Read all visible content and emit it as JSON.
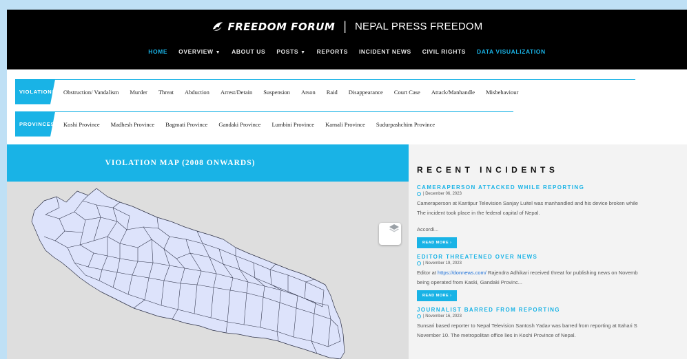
{
  "brand": {
    "logo_text": "FREEDOM FORUM",
    "separator": "|",
    "site_title": "NEPAL PRESS FREEDOM"
  },
  "nav": {
    "items": [
      {
        "label": "HOME",
        "active": true
      },
      {
        "label": "OVERVIEW",
        "caret": "▼"
      },
      {
        "label": "ABOUT US"
      },
      {
        "label": "POSTS",
        "caret": "▼"
      },
      {
        "label": "REPORTS"
      },
      {
        "label": "INCIDENT NEWS"
      },
      {
        "label": "CIVIL RIGHTS"
      },
      {
        "label": "DATA VISUALIZATION",
        "active": true
      }
    ]
  },
  "violation_filter": {
    "tag": "VIOLATIONS",
    "items": [
      "Obstruction/ Vandalism",
      "Murder",
      "Threat",
      "Abduction",
      "Arrest/Detain",
      "Suspension",
      "Arson",
      "Raid",
      "Disappearance",
      "Court Case",
      "Attack/Manhandle",
      "Misbehaviour"
    ]
  },
  "province_filter": {
    "tag": "PROVINCES",
    "items": [
      "Koshi Province",
      "Madhesh Province",
      "Bagmati Province",
      "Gandaki Province",
      "Lumbini Province",
      "Karnali Province",
      "Sudurpashchim Province"
    ]
  },
  "map": {
    "title": "VIOLATION MAP (2008 ONWARDS)",
    "layers_icon": "layers-icon"
  },
  "incidents": {
    "heading": "RECENT INCIDENTS",
    "read_more": "READ MORE ›",
    "items": [
      {
        "title": "CAMERAPERSON ATTACKED WHILE REPORTING",
        "date": "| December 06, 2023",
        "line1": "Cameraperson at Kantipur Television Sanjay Luitel was manhandled and his device broken while",
        "line2": "The incident took place in the federal capital of Nepal.",
        "line3": "Accordi..."
      },
      {
        "title": "EDITOR THREATENED OVER NEWS",
        "date": "| November 19, 2023",
        "line1_pre": "Editor at ",
        "line1_link": "https://donnews.com/",
        "line1_post": " Rajendra Adhikari received threat for publishing news on Novemb",
        "line2": "being operated from Kaski, Gandaki Provinc..."
      },
      {
        "title": "JOURNALIST BARRED FROM REPORTING",
        "date": "| November 16, 2023",
        "line1": "Sunsari based reporter to Nepal Television Santosh Yadav was barred from reporting at Itahari S",
        "line2": "November 10. The metropolitan office lies in Koshi Province of Nepal."
      }
    ]
  },
  "colors": {
    "accent": "#19b3e6",
    "header_bg": "#000000",
    "map_fill": "#dde3fb",
    "map_stroke": "#2b2f45"
  }
}
